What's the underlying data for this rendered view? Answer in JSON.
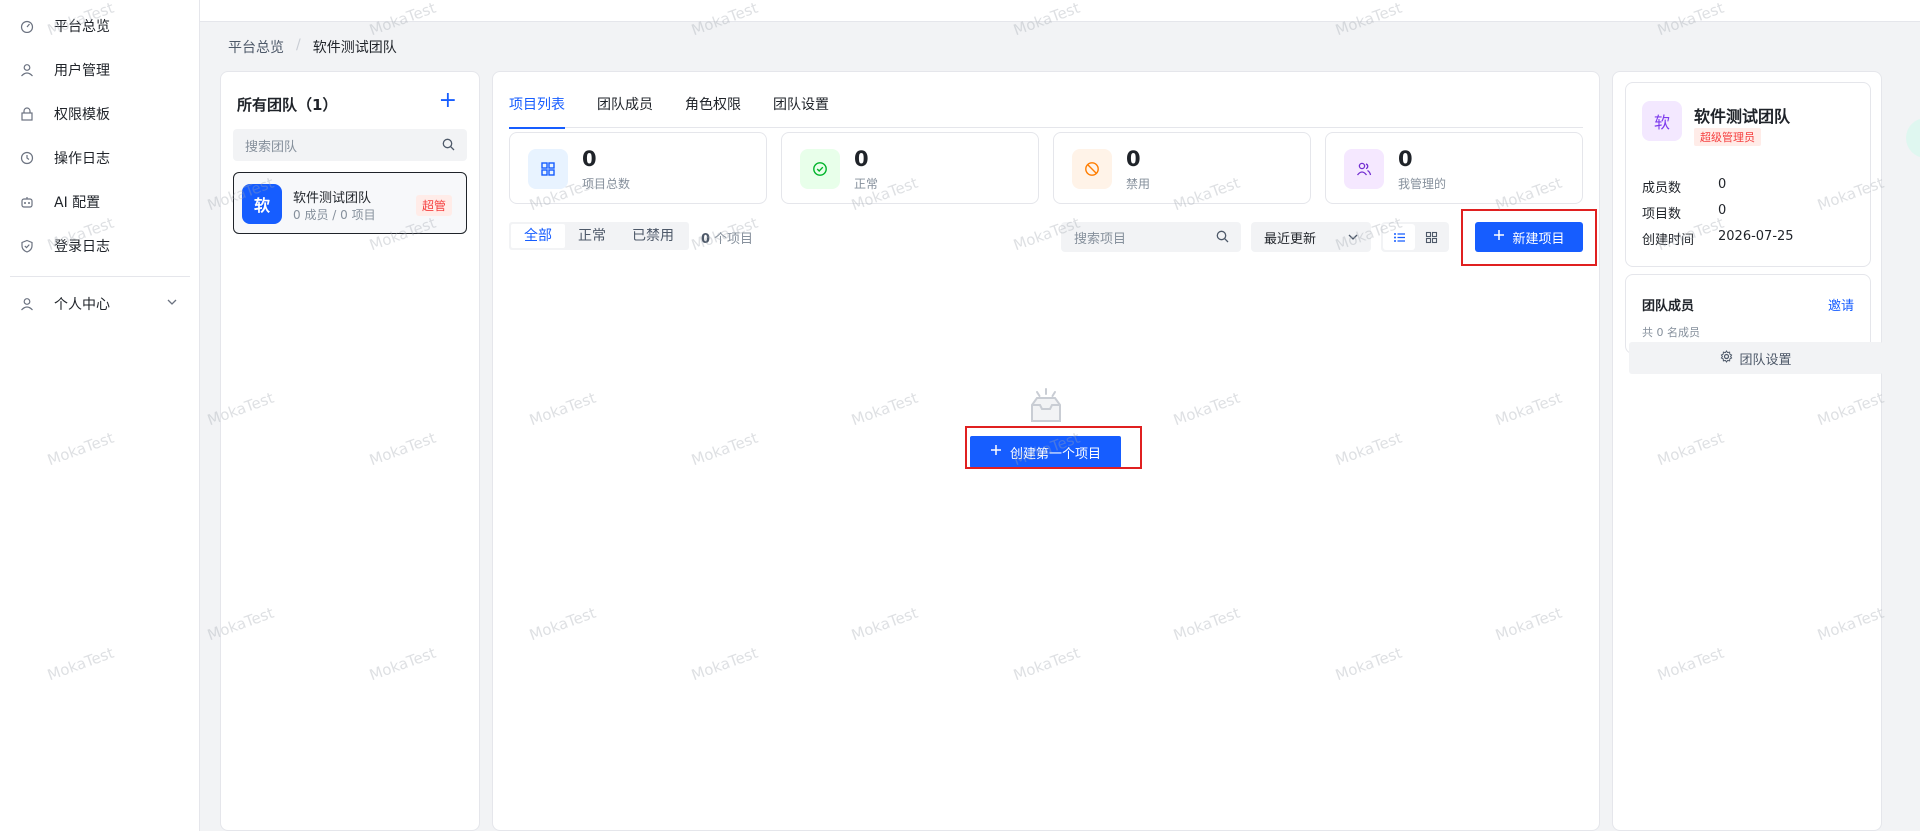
{
  "sidebar": {
    "items": [
      {
        "label": "平台总览",
        "icon": "dashboard-icon"
      },
      {
        "label": "用户管理",
        "icon": "user-icon"
      },
      {
        "label": "权限模板",
        "icon": "lock-icon"
      },
      {
        "label": "操作日志",
        "icon": "history-icon"
      },
      {
        "label": "AI 配置",
        "icon": "robot-icon"
      },
      {
        "label": "登录日志",
        "icon": "shield-icon"
      }
    ],
    "personal": {
      "label": "个人中心",
      "icon": "user-icon"
    }
  },
  "breadcrumb": {
    "root": "平台总览",
    "separator": "/",
    "current": "软件测试团队"
  },
  "teams": {
    "title": "所有团队（1）",
    "add_label": "+",
    "search_placeholder": "搜索团队",
    "list": [
      {
        "avatar": "软",
        "name": "软件测试团队",
        "meta": "0 成员 / 0 项目",
        "badge": "超管"
      }
    ]
  },
  "main": {
    "tabs": [
      {
        "label": "项目列表",
        "active": true
      },
      {
        "label": "团队成员",
        "active": false
      },
      {
        "label": "角色权限",
        "active": false
      },
      {
        "label": "团队设置",
        "active": false
      }
    ],
    "stats": [
      {
        "value": "0",
        "label": "项目总数",
        "icon": "grid-icon",
        "color": "#165dff",
        "bg": "#e8f3ff"
      },
      {
        "value": "0",
        "label": "正常",
        "icon": "check-circle-icon",
        "color": "#00b42a",
        "bg": "#e8ffea"
      },
      {
        "value": "0",
        "label": "禁用",
        "icon": "ban-icon",
        "color": "#ff7d00",
        "bg": "#fff3e8"
      },
      {
        "value": "0",
        "label": "我管理的",
        "icon": "users-icon",
        "color": "#722ed1",
        "bg": "#f5e8ff"
      }
    ],
    "filters": [
      {
        "label": "全部",
        "active": true
      },
      {
        "label": "正常",
        "active": false
      },
      {
        "label": "已禁用",
        "active": false
      }
    ],
    "project_count": {
      "value": "0",
      "unit": "个项目"
    },
    "search_placeholder": "搜索项目",
    "sort": "最近更新",
    "new_project_label": "新建项目",
    "create_first_label": "创建第一个项目"
  },
  "info": {
    "avatar": "软",
    "name": "软件测试团队",
    "role": "超级管理员",
    "fields": [
      {
        "key": "成员数",
        "value": "0"
      },
      {
        "key": "项目数",
        "value": "0"
      },
      {
        "key": "创建时间",
        "value": "2026-07-25"
      }
    ],
    "members_title": "团队成员",
    "invite_label": "邀请",
    "members_count": "共 0 名成员",
    "settings_label": "团队设置"
  },
  "watermark": "MokaTest",
  "colors": {
    "primary": "#165dff",
    "danger": "#f53f3f",
    "highlight": "#e02020"
  }
}
